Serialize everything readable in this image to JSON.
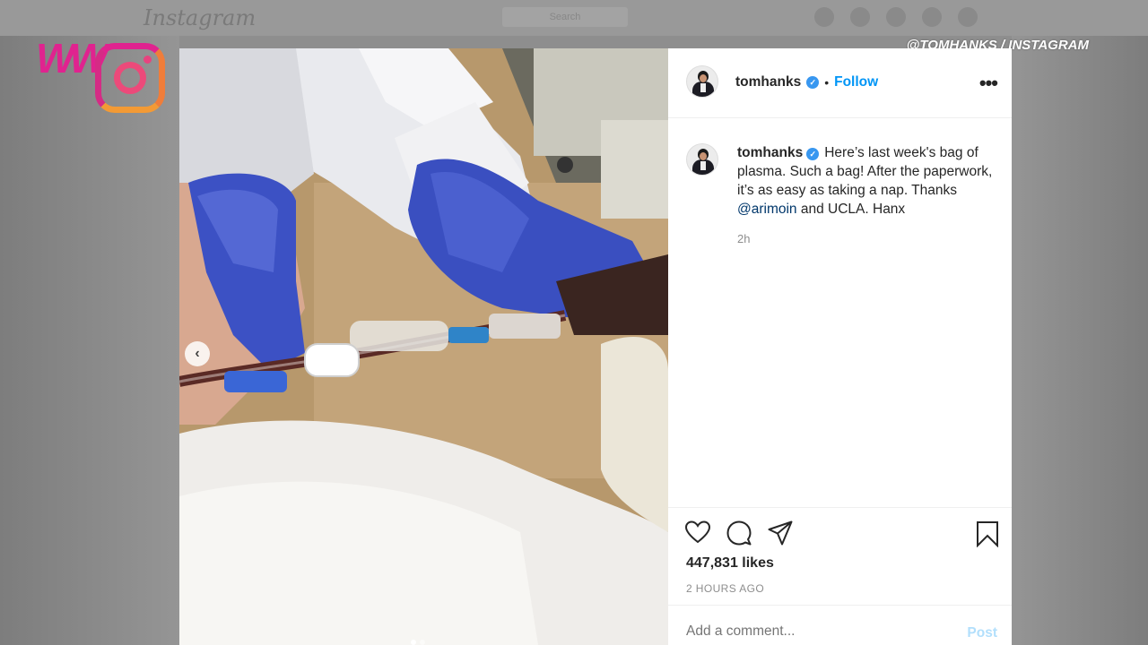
{
  "background": {
    "wordmark": "Instagram",
    "search_placeholder": "Search"
  },
  "watermark": {
    "logo_text": "WW",
    "credit": "@TOMHANKS / INSTAGRAM"
  },
  "post": {
    "header": {
      "username": "tomhanks",
      "separator": "•",
      "follow_label": "Follow",
      "more_label": "•••"
    },
    "caption": {
      "username": "tomhanks",
      "text_before_mention": "Here’s last week's bag of plasma. Such a bag!  After the paperwork, it’s as easy as taking a nap.  Thanks ",
      "mention": "@arimoin",
      "text_after_mention": " and UCLA. Hanx",
      "age": "2h"
    },
    "likes": "447,831 likes",
    "timestamp": "2 HOURS AGO",
    "comment_placeholder": "Add a comment...",
    "post_button": "Post",
    "carousel_prev": "‹"
  },
  "colors": {
    "accent": "#0095f6",
    "verified": "#3897f0",
    "watermark_pink": "#e0238f"
  },
  "icons": [
    "heart-icon",
    "comment-icon",
    "share-icon",
    "bookmark-icon",
    "verified-icon",
    "more-icon",
    "chevron-left-icon"
  ]
}
